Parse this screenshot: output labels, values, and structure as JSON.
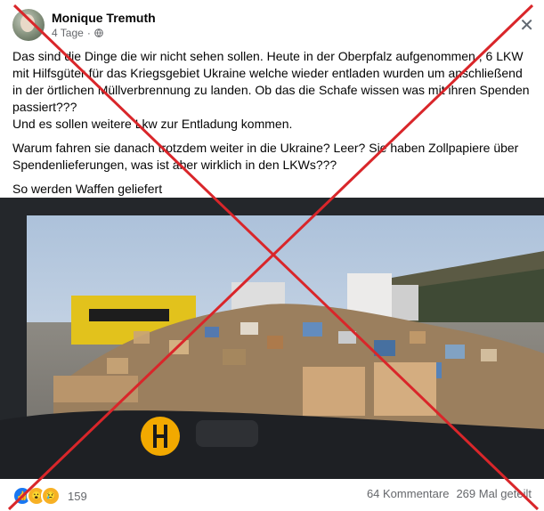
{
  "post": {
    "author": "Monique Tremuth",
    "timestamp": "4 Tage",
    "separator": "·",
    "close_icon": "close-icon",
    "paragraphs": [
      "Das sind die Dinge die wir nicht sehen sollen. Heute in der Oberpfalz aufgenommen , 6 LKW mit Hilfsgüter für das Kriegsgebiet Ukraine welche wieder entladen wurden um anschließend in der örtlichen Müllverbrennung zu landen. Ob das die Schafe wissen was mit ihren Spenden passiert???\nUnd es sollen weitere Lkw zur Entladung kommen.",
      "Warum fahren sie danach trotzdem weiter in die Ukraine? Leer? Sie haben Zollpapiere über Spendenlieferungen, was ist aber wirklich in den LKWs???",
      "So werden Waffen geliefert"
    ]
  },
  "footer": {
    "reaction_count": "159",
    "comments": "64 Kommentare",
    "shares": "269 Mal geteilt"
  },
  "colors": {
    "cross": "#d9262a",
    "text_secondary": "#65676b"
  }
}
